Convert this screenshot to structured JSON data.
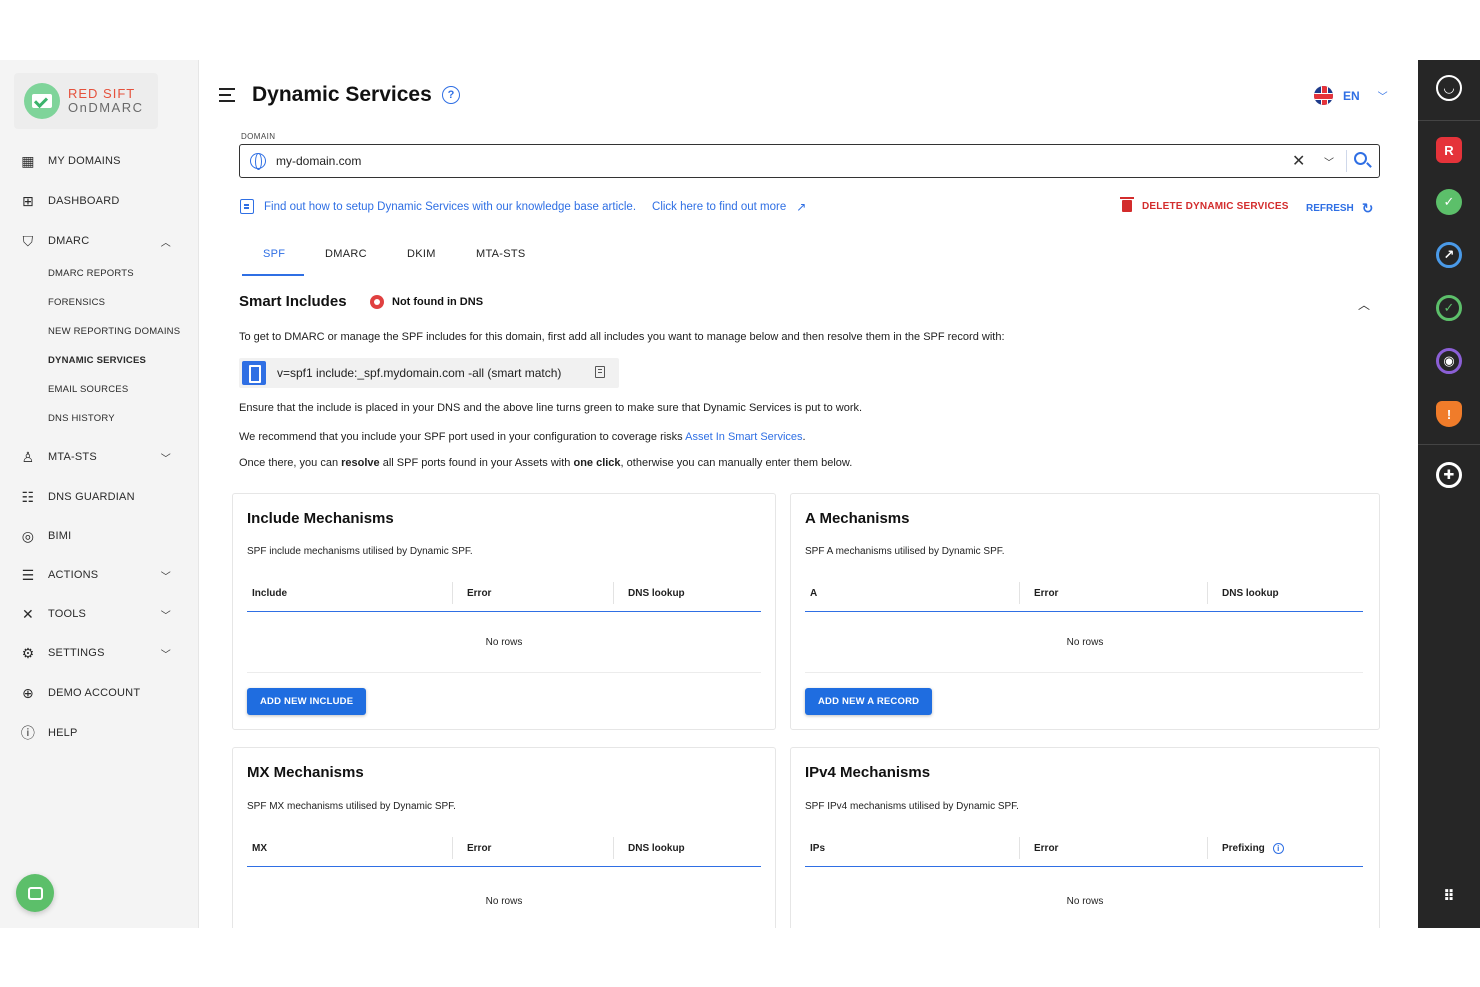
{
  "logo": {
    "line1": "RED SIFT",
    "line2": "OnDMARC"
  },
  "sidebar": {
    "items": [
      {
        "label": "MY DOMAINS",
        "icon": "building-icon"
      },
      {
        "label": "DASHBOARD",
        "icon": "grid-icon"
      },
      {
        "label": "DMARC",
        "icon": "shield-icon",
        "expanded": true
      },
      {
        "label": "MTA-STS",
        "icon": "lock-icon"
      },
      {
        "label": "DNS GUARDIAN",
        "icon": "dns-guardian-icon"
      },
      {
        "label": "BIMI",
        "icon": "bimi-icon"
      },
      {
        "label": "ACTIONS",
        "icon": "actions-icon"
      },
      {
        "label": "TOOLS",
        "icon": "tools-icon"
      },
      {
        "label": "SETTINGS",
        "icon": "settings-icon"
      },
      {
        "label": "DEMO ACCOUNT",
        "icon": "demo-account-icon"
      },
      {
        "label": "HELP",
        "icon": "help-icon"
      }
    ],
    "dmarc_sub": [
      "DMARC REPORTS",
      "FORENSICS",
      "NEW REPORTING DOMAINS",
      "DYNAMIC SERVICES",
      "EMAIL SOURCES",
      "DNS HISTORY"
    ],
    "active_sub": "DYNAMIC SERVICES"
  },
  "header": {
    "title": "Dynamic Services",
    "lang": "EN"
  },
  "domain": {
    "label": "DOMAIN",
    "value": "my-domain.com"
  },
  "info": {
    "kb_text": "Find out how to setup Dynamic Services with our knowledge base article.",
    "more_text": "Click here to find out more",
    "delete_label": "DELETE DYNAMIC SERVICES",
    "refresh_label": "REFRESH"
  },
  "tabs": [
    "SPF",
    "DMARC",
    "DKIM",
    "MTA-STS"
  ],
  "smart": {
    "title": "Smart Includes",
    "status": "Not found in DNS",
    "intro": "To get to DMARC or manage the SPF includes for this domain, first add all includes you want to manage below and then resolve them in the SPF record with:",
    "record": "v=spf1 include:_spf.mydomain.com -all (smart match)",
    "ensure": "Ensure that the include is placed in your DNS and the above line turns green to make sure that Dynamic Services is put to work.",
    "recommend_pre": "We recommend that you include your SPF port used in your configuration to coverage risks ",
    "recommend_link": "Asset In Smart Services",
    "recommend_post": ".",
    "once_1": "Once there, you can ",
    "once_b1": "resolve",
    "once_2": " all SPF ports found in your Assets with ",
    "once_b2": "one click",
    "once_3": ", otherwise you can manually enter them below."
  },
  "cards": {
    "include": {
      "title": "Include Mechanisms",
      "desc": "SPF include mechanisms utilised by Dynamic SPF.",
      "cols": [
        "Include",
        "Error",
        "DNS lookup"
      ],
      "empty": "No rows",
      "button": "ADD NEW INCLUDE"
    },
    "a": {
      "title": "A Mechanisms",
      "desc": "SPF A mechanisms utilised by Dynamic SPF.",
      "cols": [
        "A",
        "Error",
        "DNS lookup"
      ],
      "empty": "No rows",
      "button": "ADD NEW A RECORD"
    },
    "mx": {
      "title": "MX Mechanisms",
      "desc": "SPF MX mechanisms utilised by Dynamic SPF.",
      "cols": [
        "MX",
        "Error",
        "DNS lookup"
      ],
      "empty": "No rows"
    },
    "ipv4": {
      "title": "IPv4 Mechanisms",
      "desc": "SPF IPv4 mechanisms utilised by Dynamic SPF.",
      "cols": [
        "IPs",
        "Error",
        "Prefixing"
      ],
      "empty": "No rows"
    }
  },
  "rail": [
    "account-icon",
    "redsift-icon",
    "ondmarc-icon",
    "brand-trust-icon",
    "certificates-icon",
    "asm-icon",
    "shield-orange-icon",
    "support-icon",
    "apps-grid-icon"
  ],
  "colors": {
    "accent": "#2f6fe4",
    "danger": "#d32c2c",
    "rail": "#262626"
  }
}
